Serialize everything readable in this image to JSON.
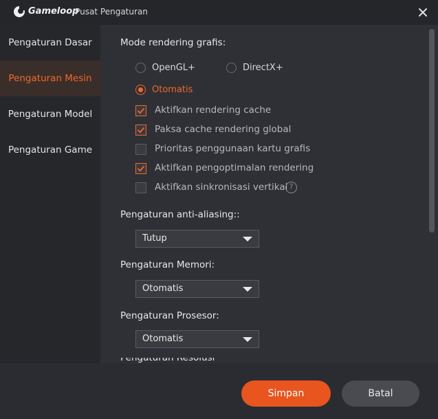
{
  "window": {
    "brand": "Gameloop",
    "title_rest": "- Pusat Pengaturan"
  },
  "sidebar": {
    "items": [
      {
        "label": "Pengaturan Dasar",
        "active": false
      },
      {
        "label": "Pengaturan Mesin",
        "active": true
      },
      {
        "label": "Pengaturan Model",
        "active": false
      },
      {
        "label": "Pengaturan Game",
        "active": false
      }
    ]
  },
  "rendering": {
    "label": "Mode rendering grafis:",
    "options": [
      {
        "label": "OpenGL+",
        "checked": false
      },
      {
        "label": "DirectX+",
        "checked": false
      },
      {
        "label": "Otomatis",
        "checked": true
      }
    ],
    "checkboxes": [
      {
        "label": "Aktifkan rendering cache",
        "checked": true
      },
      {
        "label": "Paksa cache rendering global",
        "checked": true
      },
      {
        "label": "Prioritas penggunaan kartu grafis",
        "checked": false
      },
      {
        "label": "Aktifkan pengoptimalan rendering",
        "checked": true
      },
      {
        "label": "Aktifkan sinkronisasi vertikal",
        "checked": false
      }
    ],
    "help_glyph": "?"
  },
  "antialias": {
    "label": "Pengaturan anti-aliasing::",
    "value": "Tutup"
  },
  "memory": {
    "label": "Pengaturan Memori:",
    "value": "Otomatis"
  },
  "processor": {
    "label": "Pengaturan Prosesor:",
    "value": "Otomatis"
  },
  "resolution": {
    "label": "Pengaturan Resolusi"
  },
  "footer": {
    "save_label": "Simpan",
    "cancel_label": "Batal"
  },
  "colors": {
    "accent": "#f0682c",
    "save_button": "#e8551f",
    "background": "#2f3035"
  }
}
